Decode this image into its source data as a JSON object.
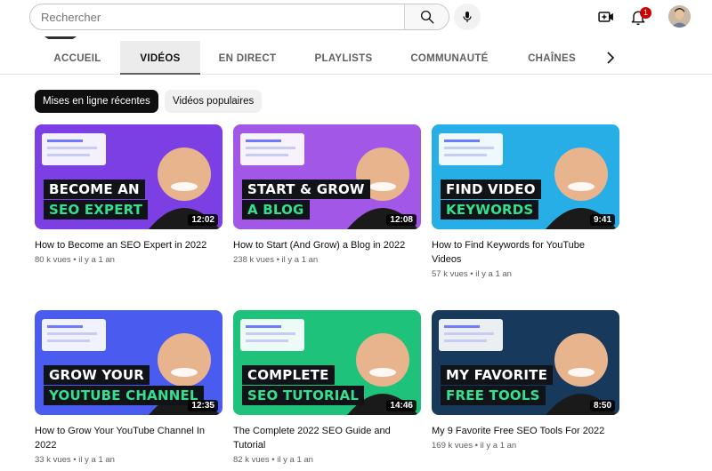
{
  "search": {
    "placeholder": "Rechercher"
  },
  "notifications": {
    "count": "1"
  },
  "tabs": [
    {
      "label": "ACCUEIL"
    },
    {
      "label": "VIDÉOS"
    },
    {
      "label": "EN DIRECT"
    },
    {
      "label": "PLAYLISTS"
    },
    {
      "label": "COMMUNAUTÉ"
    },
    {
      "label": "CHAÎNES"
    }
  ],
  "active_tab": "VIDÉOS",
  "chips": [
    {
      "label": "Mises en ligne récentes"
    },
    {
      "label": "Vidéos populaires"
    }
  ],
  "videos": [
    {
      "title": "How to Become an SEO Expert in 2022",
      "meta": "80 k vues • il y a 1 an",
      "duration": "12:02",
      "caption1": "BECOME AN",
      "caption2": "SEO EXPERT",
      "color": "#7b3fe4"
    },
    {
      "title": "How to Start (And Grow) a Blog in 2022",
      "meta": "238 k vues • il y a 1 an",
      "duration": "12:08",
      "caption1": "START & GROW",
      "caption2": "A BLOG",
      "color": "#a257e6"
    },
    {
      "title": "How to Find Keywords for YouTube Videos",
      "meta": "57 k vues • il y a 1 an",
      "duration": "9:41",
      "caption1": "FIND VIDEO",
      "caption2": "KEYWORDS",
      "color": "#27aee6"
    },
    {
      "title": "How to Grow Your YouTube Channel In 2022",
      "meta": "33 k vues • il y a 1 an",
      "duration": "12:35",
      "caption1": "GROW YOUR",
      "caption2": "YOUTUBE CHANNEL",
      "color": "#4a5cf0"
    },
    {
      "title": "The Complete 2022 SEO Guide and Tutorial",
      "meta": "82 k vues • il y a 1 an",
      "duration": "14:46",
      "caption1": "COMPLETE",
      "caption2": "SEO TUTORIAL",
      "color": "#1fc27a"
    },
    {
      "title": "My 9 Favorite Free SEO Tools For 2022",
      "meta": "169 k vues • il y a 1 an",
      "duration": "8:50",
      "caption1": "MY FAVORITE",
      "caption2": "FREE TOOLS",
      "color": "#173a5c"
    }
  ]
}
